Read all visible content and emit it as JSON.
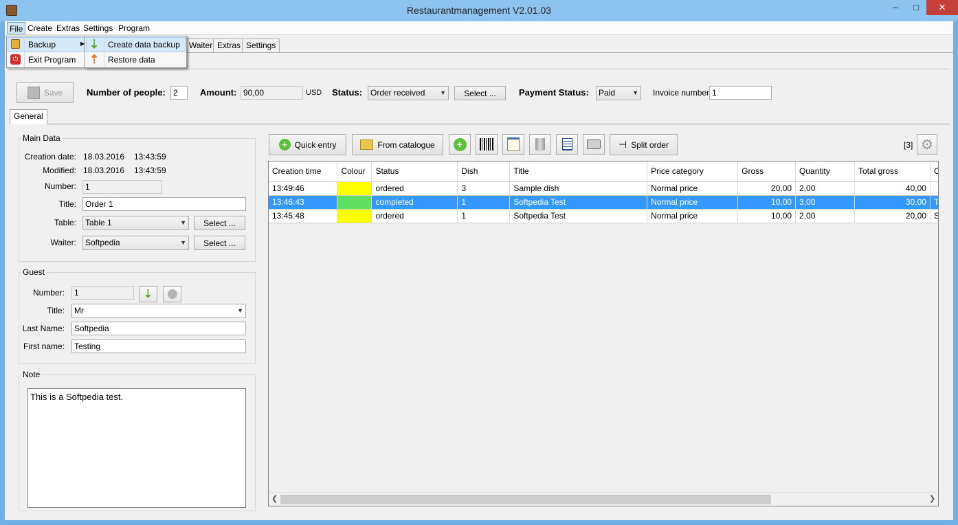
{
  "window": {
    "title": "Restaurantmanagement V2.01.03"
  },
  "menubar": {
    "items": [
      "File",
      "Create",
      "Extras",
      "Settings",
      "Program"
    ]
  },
  "file_menu": {
    "items": [
      "Backup",
      "Exit Program"
    ]
  },
  "backup_submenu": {
    "items": [
      "Create data backup",
      "Restore data"
    ]
  },
  "main_tabs": [
    "Waiter",
    "Extras",
    "Settings"
  ],
  "toolbar": {
    "save_label": "Save",
    "people_label": "Number of people:",
    "people_value": "2",
    "amount_label": "Amount:",
    "amount_value": "90,00",
    "currency": "USD",
    "status_label": "Status:",
    "status_value": "Order received",
    "select_label": "Select ...",
    "payment_label": "Payment Status:",
    "payment_value": "Paid",
    "invoice_label": "Invoice number:",
    "invoice_value": "1"
  },
  "subtab": "General",
  "main_data": {
    "title": "Main Data",
    "creation_label": "Creation date:",
    "creation_date": "18.03.2016",
    "creation_time": "13:43:59",
    "modified_label": "Modified:",
    "modified_date": "18.03.2016",
    "modified_time": "13:43:59",
    "number_label": "Number:",
    "number_value": "1",
    "title_label": "Title:",
    "title_value": "Order 1",
    "table_label": "Table:",
    "table_value": "Table 1",
    "waiter_label": "Waiter:",
    "waiter_value": "Softpedia",
    "select_label": "Select ..."
  },
  "guest": {
    "title": "Guest",
    "number_label": "Number:",
    "number_value": "1",
    "title_label": "Title:",
    "title_value": "Mr",
    "lastname_label": "Last Name:",
    "lastname_value": "Softpedia",
    "firstname_label": "First name:",
    "firstname_value": "Testing"
  },
  "note": {
    "title": "Note",
    "text": "This is a Softpedia test."
  },
  "order_toolbar": {
    "quick_entry": "Quick entry",
    "from_catalogue": "From catalogue",
    "split_order": "Split order",
    "count": "[3]"
  },
  "grid": {
    "columns": [
      "Creation time",
      "Colour",
      "Status",
      "Dish",
      "Title",
      "Price category",
      "Gross",
      "Quantity",
      "Total gross",
      "C"
    ],
    "rows": [
      {
        "time": "13:49:46",
        "colour": "#ffff00",
        "status": "ordered",
        "dish": "3",
        "title": "Sample dish",
        "price_category": "Normal price",
        "gross": "20,00",
        "quantity": "2,00",
        "total": "40,00",
        "extra": "",
        "selected": false
      },
      {
        "time": "13:46:43",
        "colour": "#5ee05e",
        "status": "completed",
        "dish": "1",
        "title": "Softpedia Test",
        "price_category": "Normal price",
        "gross": "10,00",
        "quantity": "3,00",
        "total": "30,00",
        "extra": "T",
        "selected": true
      },
      {
        "time": "13:45:48",
        "colour": "#ffff00",
        "status": "ordered",
        "dish": "1",
        "title": "Softpedia Test",
        "price_category": "Normal price",
        "gross": "10,00",
        "quantity": "2,00",
        "total": "20,00",
        "extra": "S",
        "selected": false
      }
    ]
  }
}
